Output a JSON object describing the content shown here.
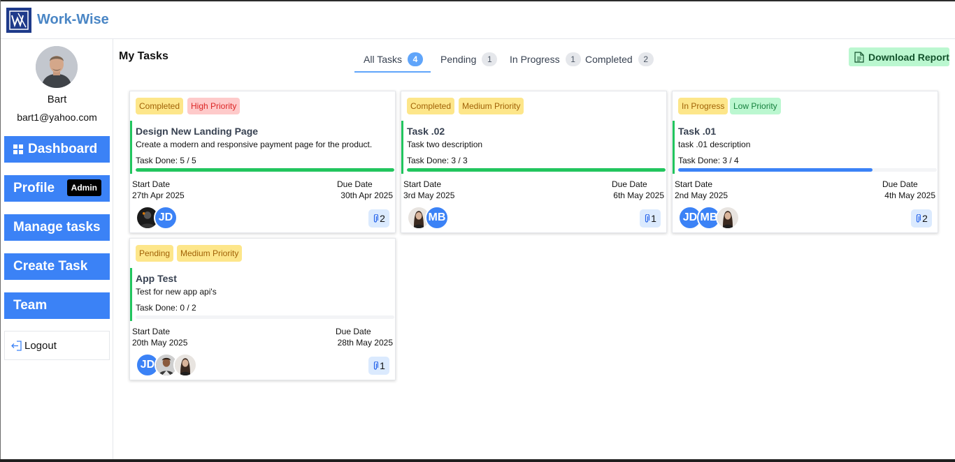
{
  "app": {
    "title": "Work-Wise",
    "logo_letter": "W"
  },
  "user": {
    "name": "Bart",
    "email": "bart1@yahoo.com"
  },
  "nav": {
    "dashboard": "Dashboard",
    "profile": "Profile",
    "admin_badge": "Admin",
    "manage_tasks": "Manage tasks",
    "create_task": "Create Task",
    "team": "Team",
    "logout": "Logout"
  },
  "main": {
    "title": "My Tasks",
    "tabs": [
      {
        "label": "All Tasks",
        "count": "4",
        "active": true
      },
      {
        "label": "Pending",
        "count": "1",
        "active": false
      },
      {
        "label": "In Progress",
        "count": "1",
        "active": false
      },
      {
        "label": "Completed",
        "count": "2",
        "active": false
      }
    ],
    "download_label": "Download Report"
  },
  "labels": {
    "start_date": "Start Date",
    "due_date": "Due Date"
  },
  "colors": {
    "accent": "#3b82f6",
    "complete_bar": "#22c55e",
    "progress_bar": "#3b82f6"
  },
  "tasks": [
    {
      "status": "Completed",
      "priority": "High Priority",
      "title": "Design New Landing Page",
      "description": "Create a modern and responsive payment page for the product.",
      "done_text": "Task Done: 5 / 5",
      "progress": 1.0,
      "start_date": "27th Apr 2025",
      "due_date": "30th Apr 2025",
      "assignees": [
        "photo",
        "JD"
      ],
      "attachments": "2"
    },
    {
      "status": "Completed",
      "priority": "Medium Priority",
      "title": "Task .02",
      "description": "Task two description",
      "done_text": "Task Done: 3 / 3",
      "progress": 1.0,
      "start_date": "3rd May 2025",
      "due_date": "6th May 2025",
      "assignees": [
        "photo",
        "MB"
      ],
      "attachments": "1"
    },
    {
      "status": "In Progress",
      "priority": "Low Priority",
      "title": "Task .01",
      "description": "task .01 description",
      "done_text": "Task Done: 3 / 4",
      "progress": 0.75,
      "start_date": "2nd May 2025",
      "due_date": "4th May 2025",
      "assignees": [
        "JD",
        "MB",
        "photo"
      ],
      "attachments": "2"
    },
    {
      "status": "Pending",
      "priority": "Medium Priority",
      "title": "App Test",
      "description": "Test for new app api's",
      "done_text": "Task Done: 0 / 2",
      "progress": 0.0,
      "start_date": "20th May 2025",
      "due_date": "28th May 2025",
      "assignees": [
        "JD",
        "photo",
        "photo"
      ],
      "attachments": "1"
    }
  ]
}
